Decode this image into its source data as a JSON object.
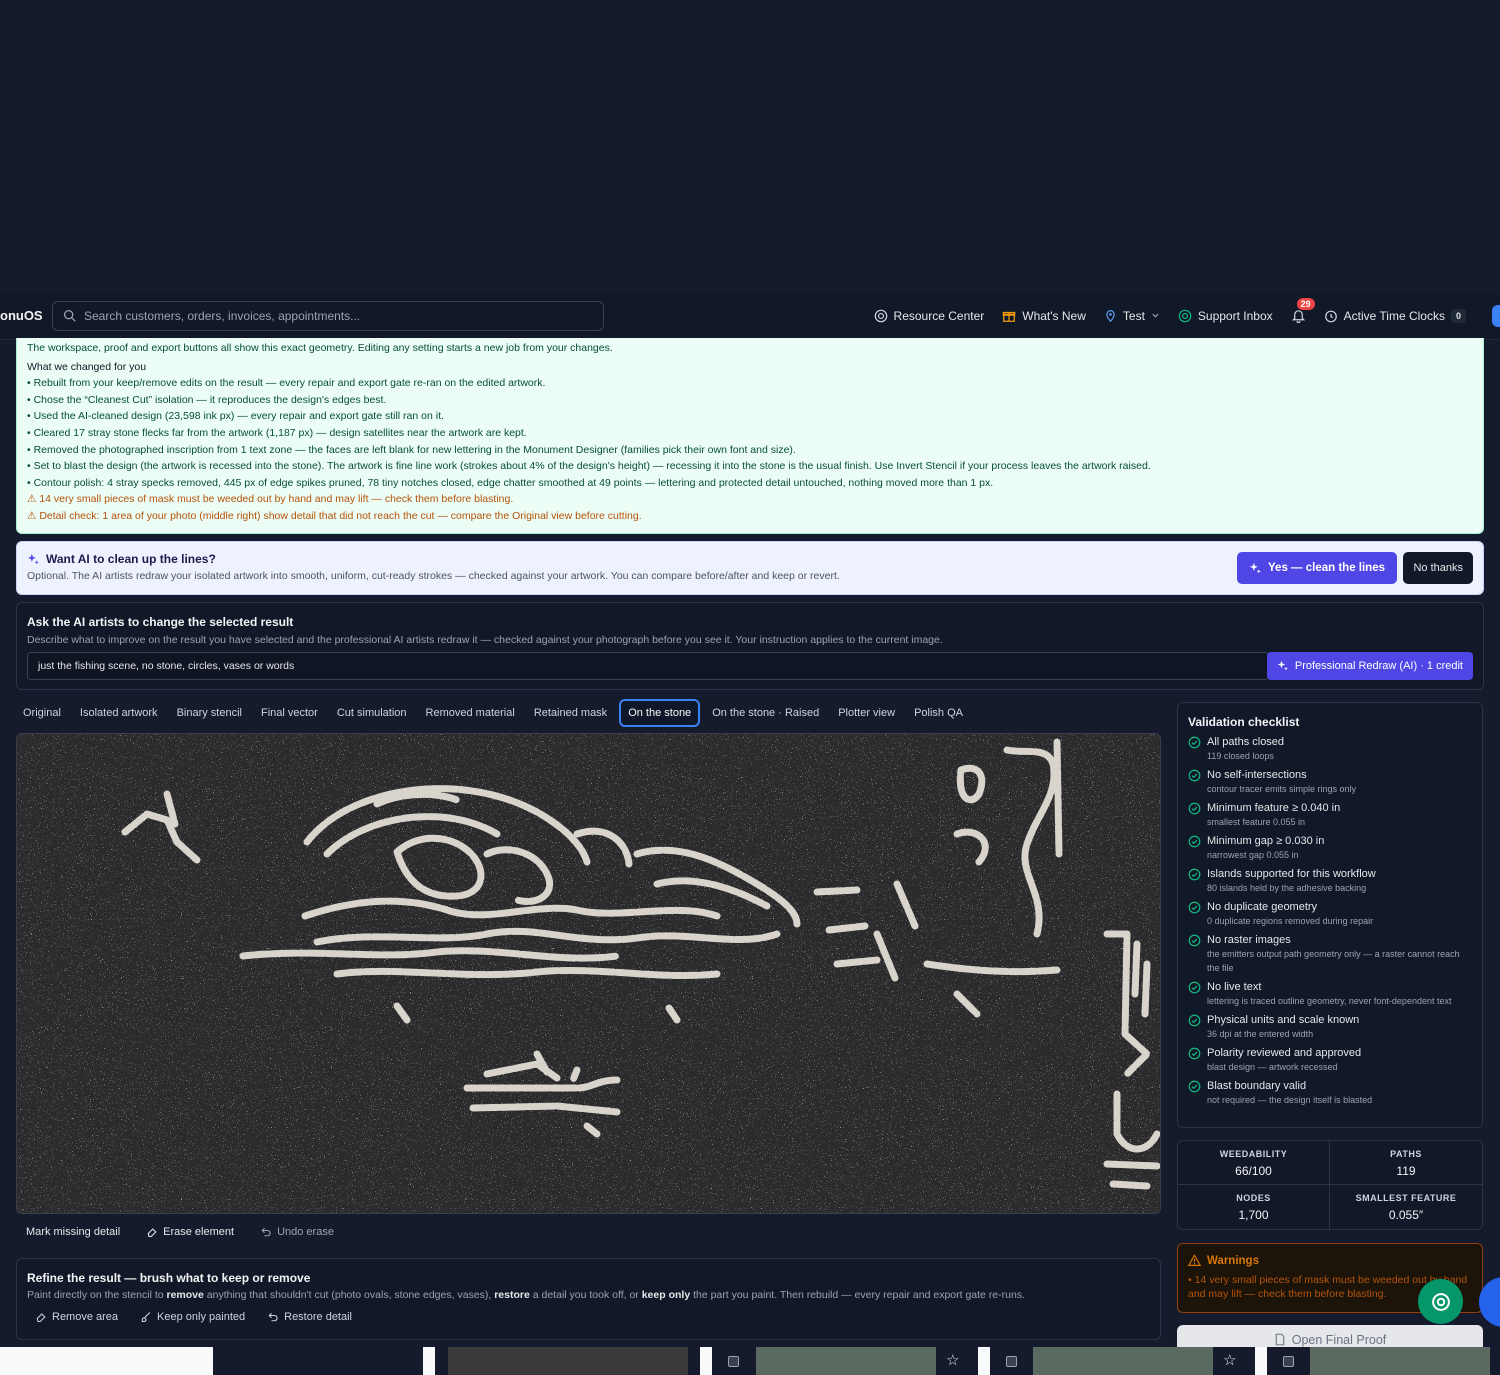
{
  "header": {
    "brand": "onuOS",
    "search_placeholder": "Search customers, orders, invoices, appointments...",
    "nav": [
      {
        "label": "Resource Center",
        "icon": "lifebuoy-icon"
      },
      {
        "label": "What's New",
        "icon": "gift-icon"
      },
      {
        "label": "Test",
        "icon": "location-pin-icon"
      },
      {
        "label": "Support Inbox",
        "icon": "support-icon"
      }
    ],
    "notifications_count": "29",
    "active_time_clocks_label": "Active Time Clocks",
    "active_time_clocks_count": "0"
  },
  "summary": {
    "intro": "The workspace, proof and export buttons all show this exact geometry. Editing any setting starts a new job from your changes.",
    "heading": "What we changed for you",
    "items": [
      "• Rebuilt from your keep/remove edits on the result — every repair and export gate re-ran on the edited artwork.",
      "• Chose the “Cleanest Cut” isolation — it reproduces the design's edges best.",
      "• Used the AI-cleaned design (23,598 ink px) — every repair and export gate still ran on it.",
      "• Cleared 17 stray stone flecks far from the artwork (1,187 px) — design satellites near the artwork are kept.",
      "• Removed the photographed inscription from 1 text zone — the faces are left blank for new lettering in the Monument Designer (families pick their own font and size).",
      "• Set to blast the design (the artwork is recessed into the stone). The artwork is fine line work (strokes about 4% of the design's height) — recessing it into the stone is the usual finish. Use Invert Stencil if your process leaves the artwork raised.",
      "• Contour polish: 4 stray specks removed, 445 px of edge spikes pruned, 78 tiny notches closed, edge chatter smoothed at 49 points — lettering and protected detail untouched, nothing moved more than 1 px."
    ],
    "warnings": [
      "⚠ 14 very small pieces of mask must be weeded out by hand and may lift — check them before blasting.",
      "⚠ Detail check: 1 area of your photo (middle right) show detail that did not reach the cut — compare the Original view before cutting."
    ]
  },
  "cleanup": {
    "title": "Want AI to clean up the lines?",
    "subtitle": "Optional. The AI artists redraw your isolated artwork into smooth, uniform, cut-ready strokes — checked against your artwork. You can compare before/after and keep or revert.",
    "yes_label": "Yes — clean the lines",
    "no_label": "No thanks"
  },
  "ask": {
    "title": "Ask the AI artists to change the selected result",
    "subtitle": "Describe what to improve on the result you have selected and the professional AI artists redraw it — checked against your photograph before you see it. Your instruction applies to the current image.",
    "input_value": "just the fishing scene, no stone, circles, vases or words",
    "redraw_label": "Professional Redraw (AI) · 1 credit"
  },
  "tabs": [
    "Original",
    "Isolated artwork",
    "Binary stencil",
    "Final vector",
    "Cut simulation",
    "Removed material",
    "Retained mask",
    "On the stone",
    "On the stone · Raised",
    "Plotter view",
    "Polish QA"
  ],
  "active_tab": "On the stone",
  "tools": {
    "mark_missing": "Mark missing detail",
    "erase": "Erase element",
    "undo": "Undo erase"
  },
  "refine": {
    "title": "Refine the result — brush what to keep or remove",
    "text_a": "Paint directly on the stencil to ",
    "kw_remove": "remove",
    "text_b": " anything that shouldn't cut (photo ovals, stone edges, vases), ",
    "kw_restore": "restore",
    "text_c": " a detail you took off, or ",
    "kw_keep": "keep only",
    "text_d": " the part you paint. Then rebuild — every repair and export gate re-runs.",
    "remove_area": "Remove area",
    "keep_only": "Keep only painted",
    "restore_detail": "Restore detail"
  },
  "checklist": {
    "title": "Validation checklist",
    "items": [
      {
        "label": "All paths closed",
        "detail": "119 closed loops"
      },
      {
        "label": "No self-intersections",
        "detail": "contour tracer emits simple rings only"
      },
      {
        "label": "Minimum feature ≥ 0.040 in",
        "detail": "smallest feature 0.055 in"
      },
      {
        "label": "Minimum gap ≥ 0.030 in",
        "detail": "narrowest gap 0.055 in"
      },
      {
        "label": "Islands supported for this workflow",
        "detail": "80 islands held by the adhesive backing"
      },
      {
        "label": "No duplicate geometry",
        "detail": "0 duplicate regions removed during repair"
      },
      {
        "label": "No raster images",
        "detail": "the emitters output path geometry only — a raster cannot reach the file"
      },
      {
        "label": "No live text",
        "detail": "lettering is traced outline geometry, never font-dependent text"
      },
      {
        "label": "Physical units and scale known",
        "detail": "36 dpi at the entered width"
      },
      {
        "label": "Polarity reviewed and approved",
        "detail": "blast design — artwork recessed"
      },
      {
        "label": "Blast boundary valid",
        "detail": "not required — the design itself is blasted"
      }
    ]
  },
  "stats": [
    {
      "label": "WEEDABILITY",
      "value": "66/100"
    },
    {
      "label": "PATHS",
      "value": "119"
    },
    {
      "label": "NODES",
      "value": "1,700"
    },
    {
      "label": "SMALLEST FEATURE",
      "value": "0.055″"
    }
  ],
  "warnings_panel": {
    "title": "Warnings",
    "text": "• 14 very small pieces of mask must be weeded out by hand and may lift — check them before blasting."
  },
  "final_proof_label": "Open Final Proof",
  "colors": {
    "accent": "#4f46e5",
    "success": "#10b981",
    "warning": "#d97706"
  }
}
